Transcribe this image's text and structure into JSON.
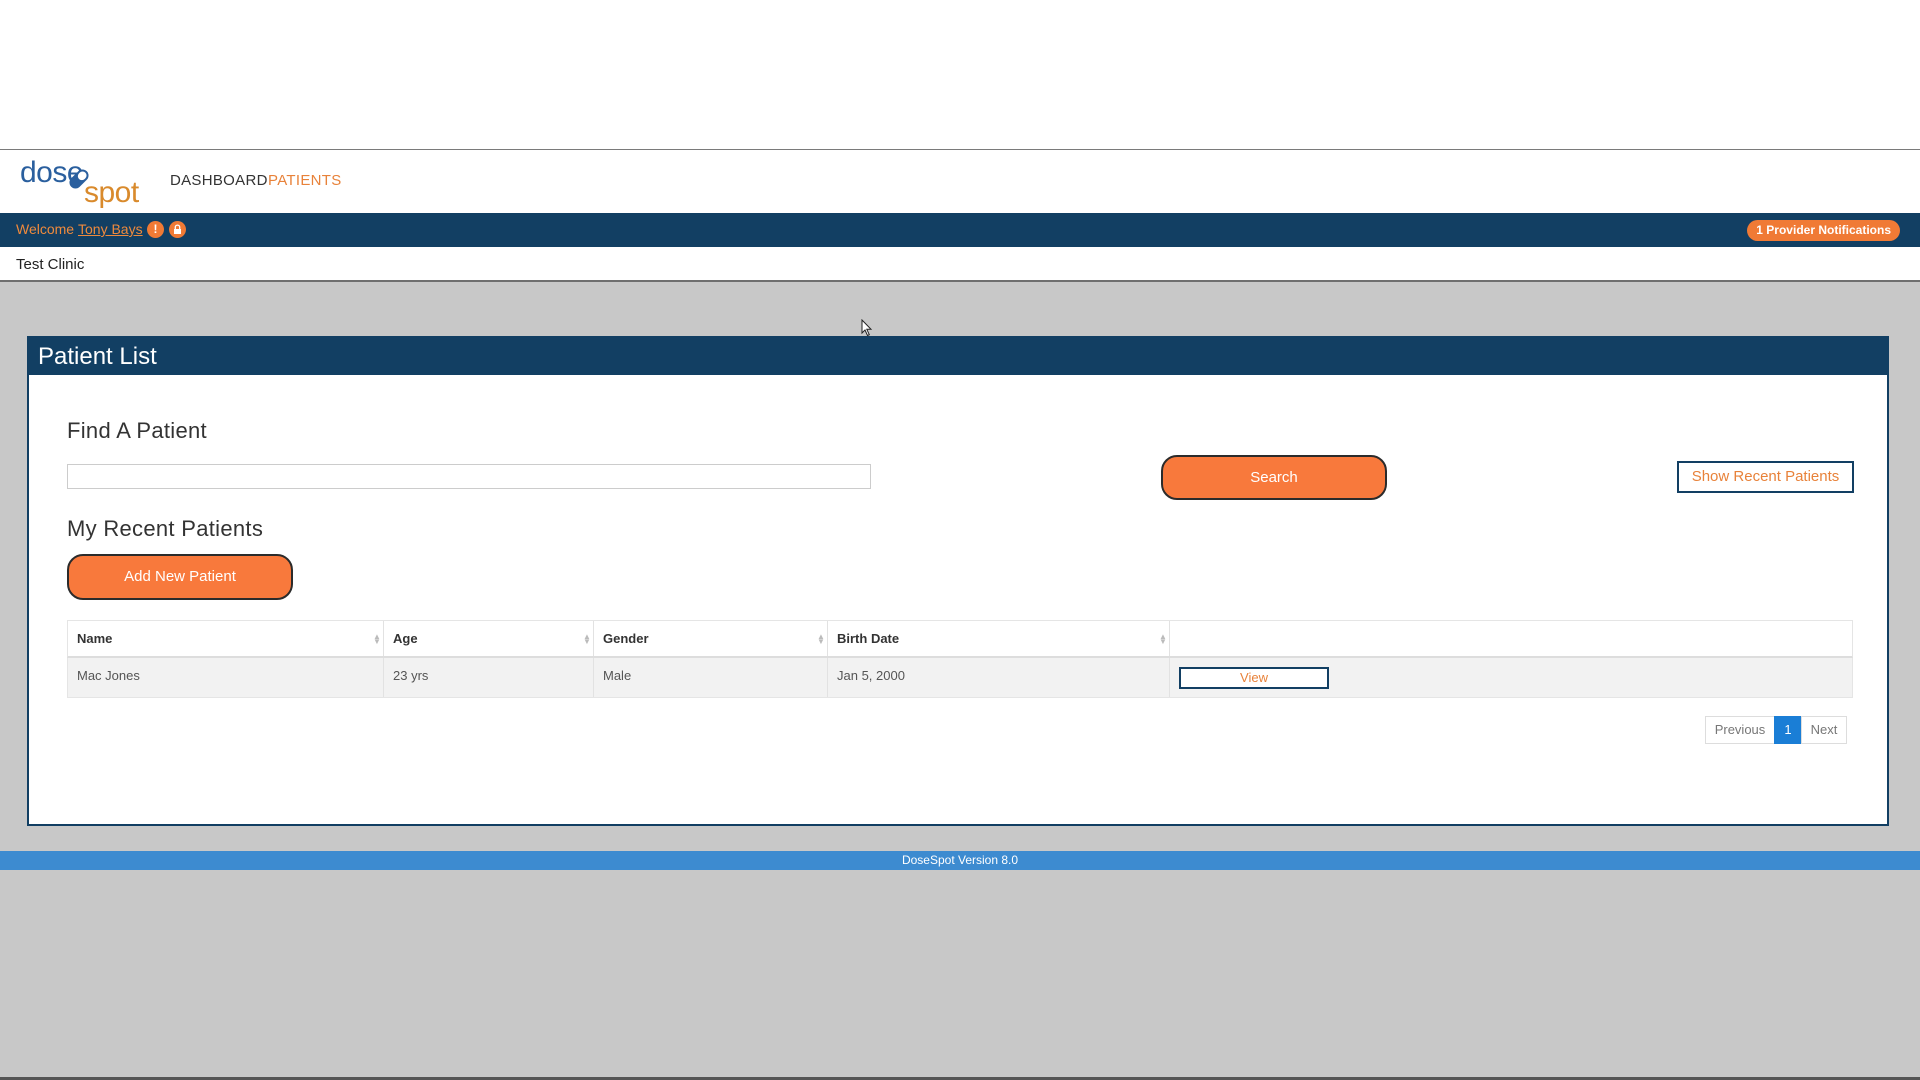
{
  "nav": {
    "logo_dose": "dose",
    "logo_spot": "spot",
    "dashboard": "DASHBOARD",
    "patients": "PATIENTS"
  },
  "welcome": {
    "text": "Welcome",
    "user": "Tony Bays",
    "alert_glyph": "!",
    "lock_glyph": "🔒",
    "notifications": "1 Provider Notifications"
  },
  "clinic": {
    "name": "Test Clinic"
  },
  "panel": {
    "title": "Patient List",
    "find_heading": "Find A Patient",
    "search_value": "",
    "search_button": "Search",
    "show_recent_button": "Show Recent Patients",
    "recent_heading": "My Recent Patients",
    "add_button": "Add New Patient"
  },
  "table": {
    "headers": [
      "Name",
      "Age",
      "Gender",
      "Birth Date"
    ],
    "rows": [
      {
        "name": "Mac Jones",
        "age": "23 yrs",
        "gender": "Male",
        "birth_date": "Jan 5, 2000",
        "action": "View"
      }
    ]
  },
  "pagination": {
    "previous": "Previous",
    "page": "1",
    "next": "Next"
  },
  "footer": {
    "version": "DoseSpot Version 8.0"
  },
  "colors": {
    "navy": "#123f63",
    "orange": "#f8793c",
    "footer_blue": "#3d8bd0",
    "page_gray": "#c8c8c8"
  }
}
